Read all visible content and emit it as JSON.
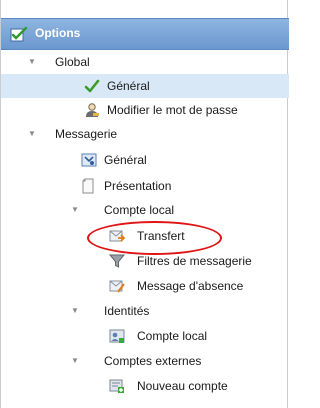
{
  "header": {
    "title": "Options",
    "icon": "options-checkbox-icon"
  },
  "tree": {
    "global": {
      "label": "Global",
      "toggle": "▼",
      "general": {
        "label": "Général",
        "icon": "green-check-icon"
      },
      "password": {
        "label": "Modifier le mot de passe",
        "icon": "user-key-icon"
      }
    },
    "messagerie": {
      "label": "Messagerie",
      "toggle": "▼",
      "general": {
        "label": "Général",
        "icon": "mail-settings-icon"
      },
      "presentation": {
        "label": "Présentation",
        "icon": "page-icon"
      },
      "compte_local": {
        "label": "Compte local",
        "toggle": "▼",
        "transfert": {
          "label": "Transfert",
          "icon": "mail-forward-icon"
        },
        "filtres": {
          "label": "Filtres de messagerie",
          "icon": "funnel-icon"
        },
        "absence": {
          "label": "Message d'absence",
          "icon": "mail-absence-icon"
        }
      },
      "identites": {
        "label": "Identités",
        "toggle": "▼",
        "compte_local": {
          "label": "Compte local",
          "icon": "identity-card-icon"
        }
      },
      "comptes_externes": {
        "label": "Comptes externes",
        "toggle": "▼",
        "nouveau": {
          "label": "Nouveau compte",
          "icon": "new-account-icon"
        }
      }
    }
  },
  "colors": {
    "header": "#6a98cf",
    "selected_row": "#d9e8f7",
    "annotation": "#e01414"
  }
}
